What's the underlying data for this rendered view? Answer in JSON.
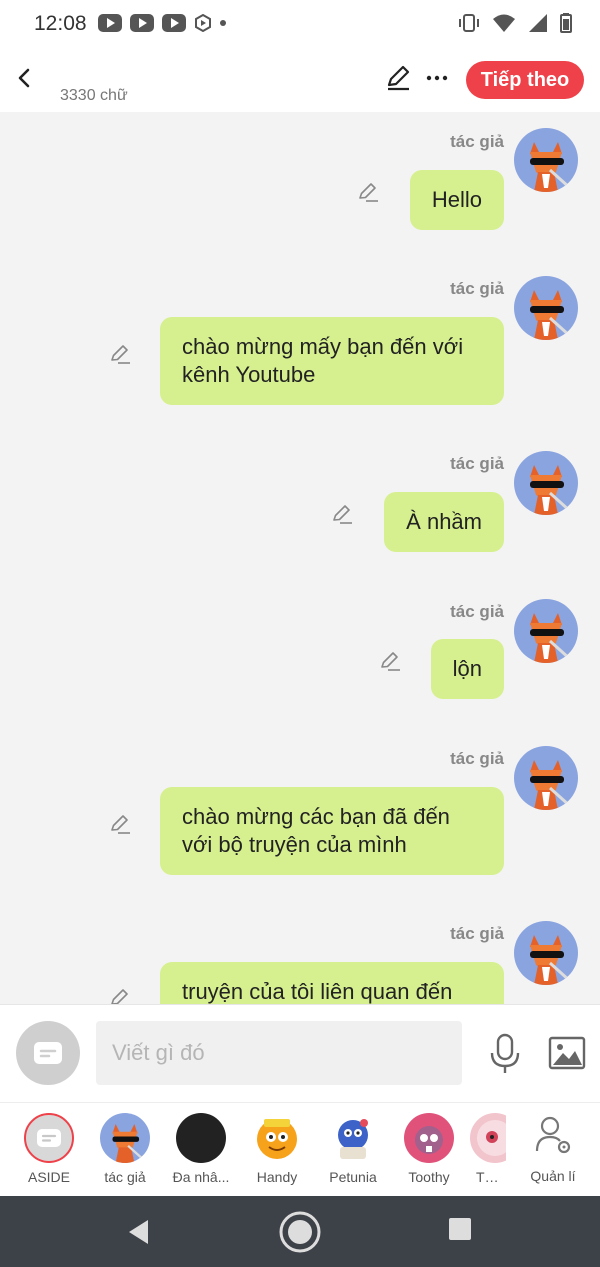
{
  "status_bar": {
    "time": "12:08",
    "left_icons": [
      "youtube-icon",
      "youtube-icon",
      "youtube-icon",
      "hexagon-play-icon",
      "dot-icon"
    ],
    "right_icons": [
      "vibrate-icon",
      "wifi-icon",
      "signal-icon",
      "battery-icon"
    ]
  },
  "header": {
    "word_count": "3330 chữ",
    "next_label": "Tiếp theo",
    "accent_color": "#ef4149"
  },
  "messages": [
    {
      "author": "tác giả",
      "text": "Hello"
    },
    {
      "author": "tác giả",
      "text": "chào mừng mấy bạn đến với kênh Youtube"
    },
    {
      "author": "tác giả",
      "text": "À nhầm"
    },
    {
      "author": "tác giả",
      "text": "lộn"
    },
    {
      "author": "tác giả",
      "text": "chào mừng các bạn đã đến với bộ truyện của mình"
    },
    {
      "author": "tác giả",
      "text": "truyện của tôi liên quan đến"
    }
  ],
  "bubble_color": "#d6f08f",
  "input": {
    "placeholder": "Viết gì đó"
  },
  "characters": [
    {
      "label": "ASIDE"
    },
    {
      "label": "tác giả"
    },
    {
      "label": "Đa nhâ..."
    },
    {
      "label": "Handy"
    },
    {
      "label": "Petunia"
    },
    {
      "label": "Toothy"
    },
    {
      "label": "The r"
    }
  ],
  "manage_label": "Quản lí"
}
